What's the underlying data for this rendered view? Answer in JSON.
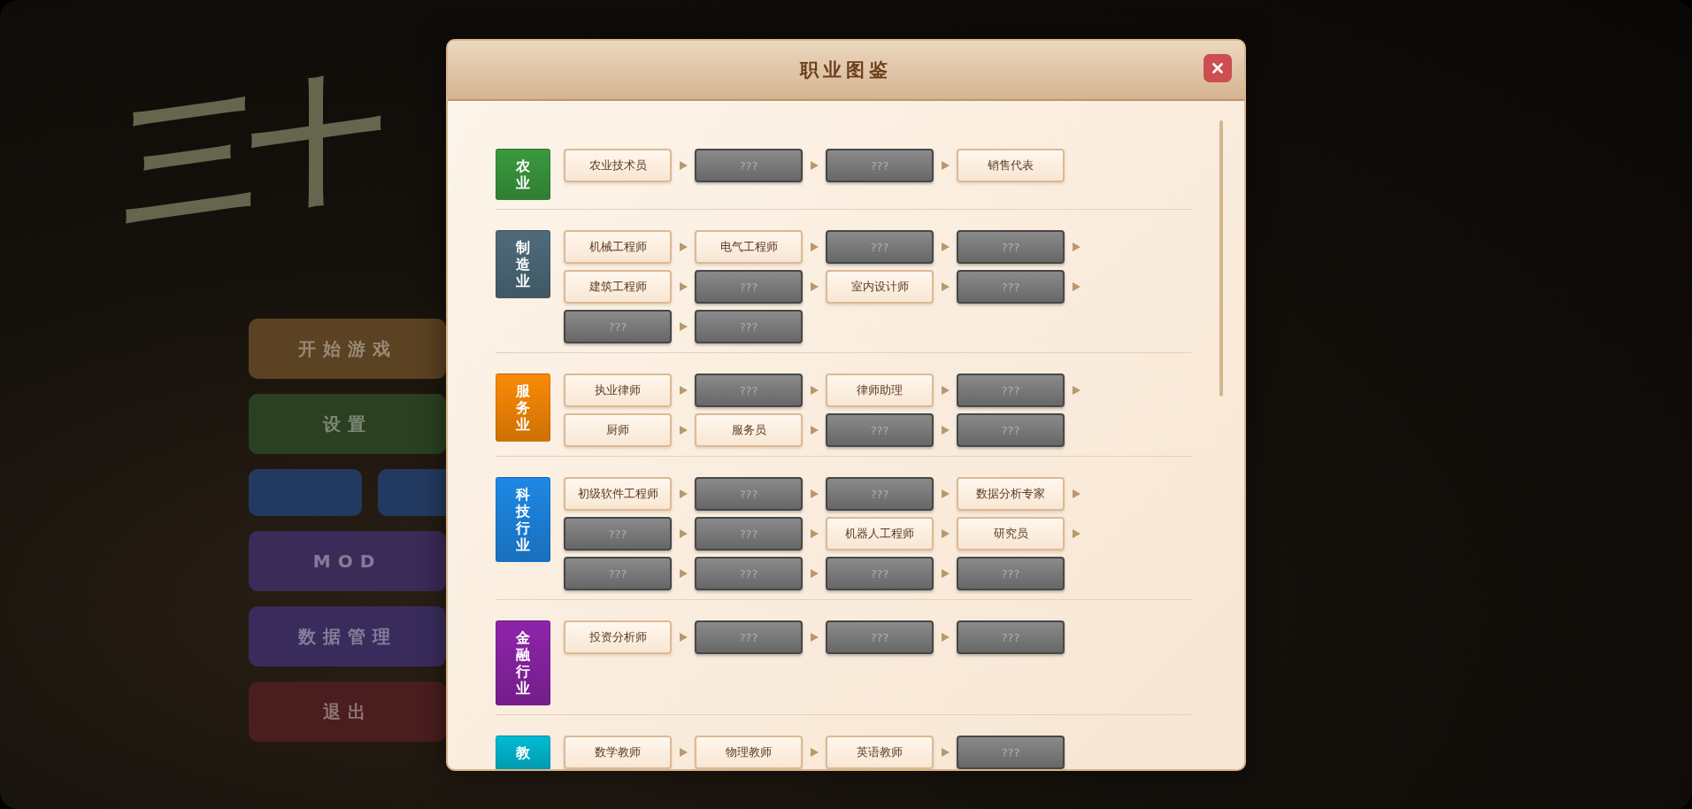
{
  "background": {
    "logo": "三十",
    "menu": [
      {
        "kind": "wide",
        "label": "开始游戏",
        "color": "#5a4222"
      },
      {
        "kind": "wide",
        "label": "设置",
        "color": "#2b4021"
      },
      {
        "kind": "pair",
        "color": "#233a60"
      },
      {
        "kind": "wide",
        "label": "MOD",
        "color": "#3a2b58"
      },
      {
        "kind": "wide",
        "label": "数据管理",
        "color": "#392c5c"
      },
      {
        "kind": "wide",
        "label": "退出",
        "color": "#4a1d1f"
      }
    ]
  },
  "dialog": {
    "title": "职业图鉴",
    "categories": [
      {
        "name": "农业",
        "color": "#3a9a3e",
        "rows": [
          {
            "continues": false,
            "jobs": [
              {
                "label": "农业技术员",
                "locked": false
              },
              {
                "label": "???",
                "locked": true
              },
              {
                "label": "???",
                "locked": true
              },
              {
                "label": "销售代表",
                "locked": false
              }
            ]
          }
        ]
      },
      {
        "name": "制造业",
        "color": "#4f6b7b",
        "rows": [
          {
            "continues": true,
            "jobs": [
              {
                "label": "机械工程师",
                "locked": false
              },
              {
                "label": "电气工程师",
                "locked": false
              },
              {
                "label": "???",
                "locked": true
              },
              {
                "label": "???",
                "locked": true
              }
            ]
          },
          {
            "continues": true,
            "jobs": [
              {
                "label": "建筑工程师",
                "locked": false
              },
              {
                "label": "???",
                "locked": true
              },
              {
                "label": "室内设计师",
                "locked": false
              },
              {
                "label": "???",
                "locked": true
              }
            ]
          },
          {
            "continues": false,
            "jobs": [
              {
                "label": "???",
                "locked": true
              },
              {
                "label": "???",
                "locked": true
              }
            ]
          }
        ]
      },
      {
        "name": "服务业",
        "color": "#fb8a06",
        "rows": [
          {
            "continues": true,
            "jobs": [
              {
                "label": "执业律师",
                "locked": false
              },
              {
                "label": "???",
                "locked": true
              },
              {
                "label": "律师助理",
                "locked": false
              },
              {
                "label": "???",
                "locked": true
              }
            ]
          },
          {
            "continues": false,
            "jobs": [
              {
                "label": "厨师",
                "locked": false
              },
              {
                "label": "服务员",
                "locked": false
              },
              {
                "label": "???",
                "locked": true
              },
              {
                "label": "???",
                "locked": true
              }
            ]
          }
        ]
      },
      {
        "name": "科技行业",
        "color": "#1e88e5",
        "rows": [
          {
            "continues": true,
            "jobs": [
              {
                "label": "初级软件工程师",
                "locked": false
              },
              {
                "label": "???",
                "locked": true
              },
              {
                "label": "???",
                "locked": true
              },
              {
                "label": "数据分析专家",
                "locked": false
              }
            ]
          },
          {
            "continues": true,
            "jobs": [
              {
                "label": "???",
                "locked": true
              },
              {
                "label": "???",
                "locked": true
              },
              {
                "label": "机器人工程师",
                "locked": false
              },
              {
                "label": "研究员",
                "locked": false
              }
            ]
          },
          {
            "continues": false,
            "jobs": [
              {
                "label": "???",
                "locked": true
              },
              {
                "label": "???",
                "locked": true
              },
              {
                "label": "???",
                "locked": true
              },
              {
                "label": "???",
                "locked": true
              }
            ]
          }
        ]
      },
      {
        "name": "金融行业",
        "color": "#8e24aa",
        "rows": [
          {
            "continues": false,
            "jobs": [
              {
                "label": "投资分析师",
                "locked": false
              },
              {
                "label": "???",
                "locked": true
              },
              {
                "label": "???",
                "locked": true
              },
              {
                "label": "???",
                "locked": true
              }
            ]
          }
        ]
      },
      {
        "name": "教",
        "color": "#00bcd4",
        "rows": [
          {
            "continues": false,
            "jobs": [
              {
                "label": "数学教师",
                "locked": false
              },
              {
                "label": "物理教师",
                "locked": false
              },
              {
                "label": "英语教师",
                "locked": false
              },
              {
                "label": "???",
                "locked": true
              }
            ]
          }
        ]
      }
    ]
  }
}
